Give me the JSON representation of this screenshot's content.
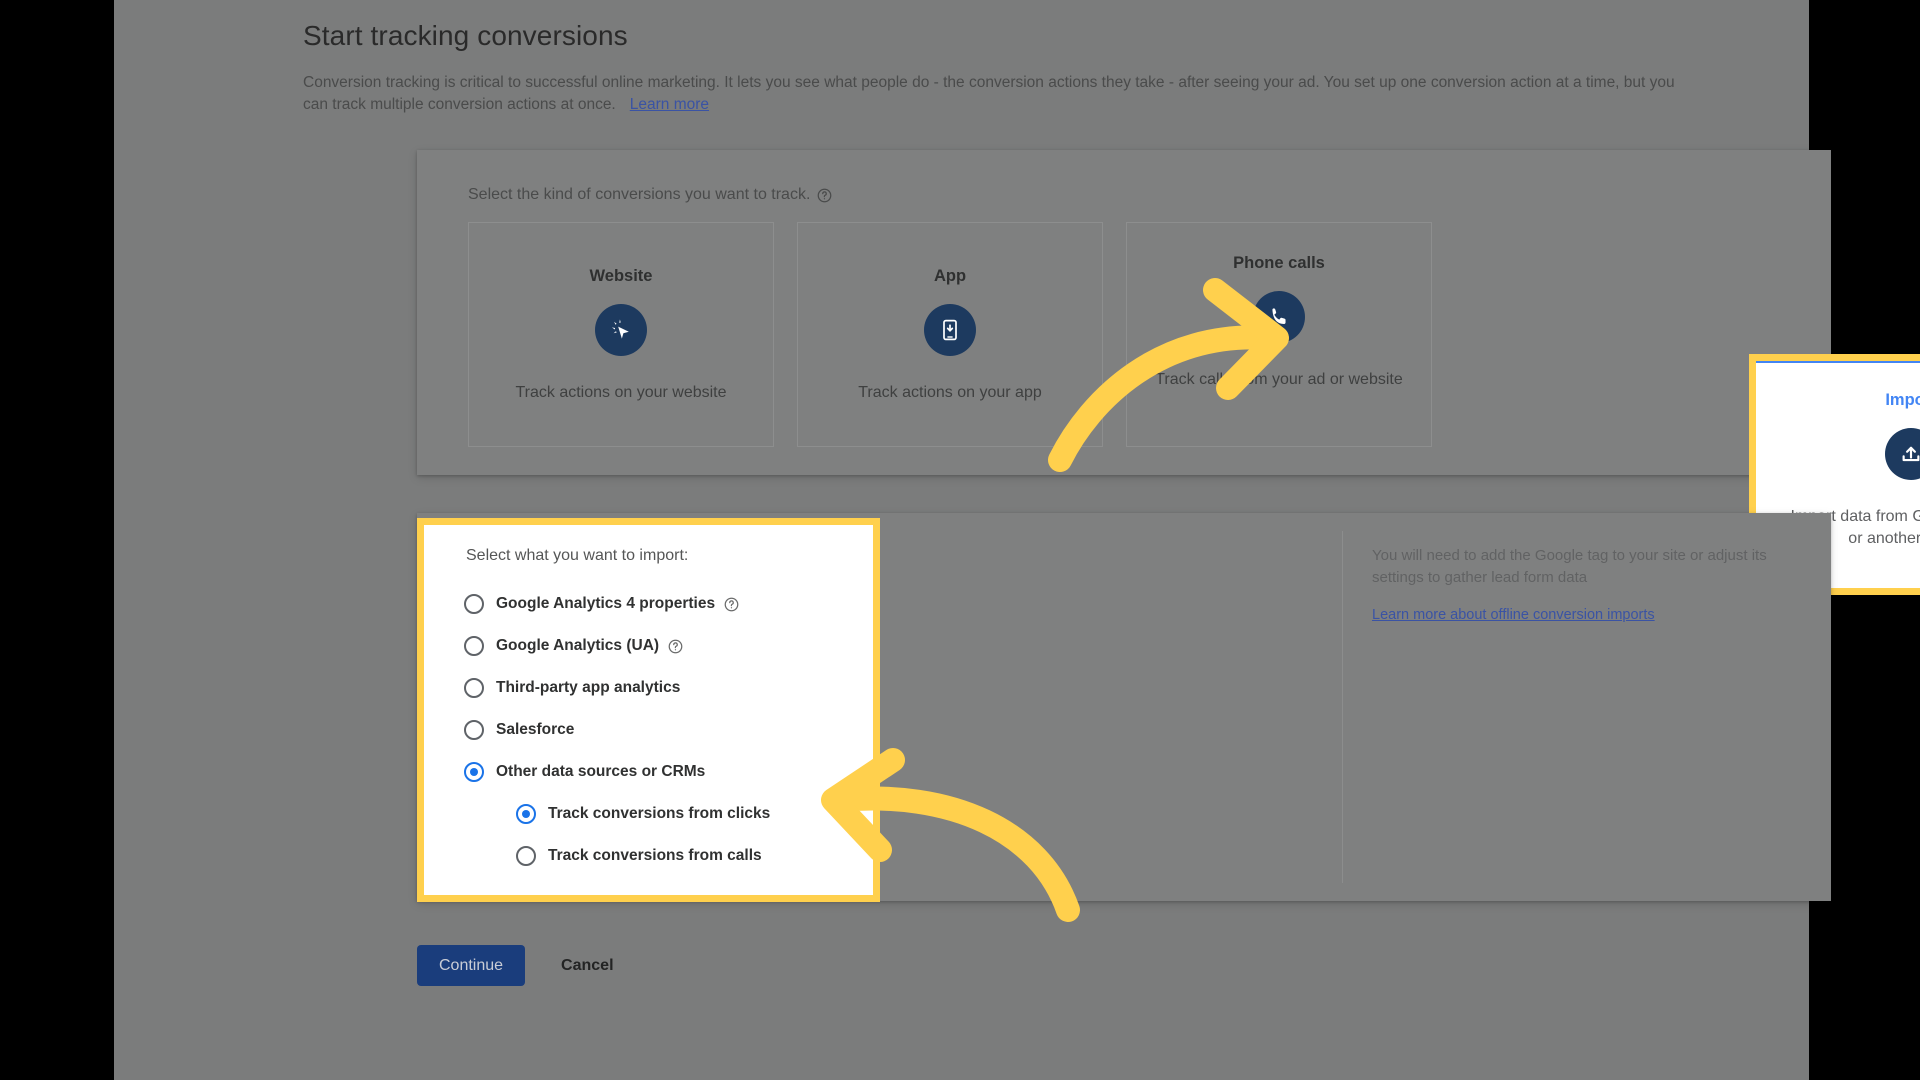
{
  "header": {
    "title": "Start tracking conversions",
    "intro": "Conversion tracking is critical to successful online marketing. It lets you see what people do - the conversion actions they take - after seeing your ad. You set up one conversion action at a time, but you can track multiple conversion actions at once.",
    "learn_more": "Learn more"
  },
  "kinds_panel": {
    "label": "Select the kind of conversions you want to track.",
    "help_icon": "help-circle-icon",
    "cards": [
      {
        "title": "Website",
        "desc": "Track actions on your website",
        "icon": "cursor-click-icon",
        "selected": false
      },
      {
        "title": "App",
        "desc": "Track actions on your app",
        "icon": "mobile-download-icon",
        "selected": false
      },
      {
        "title": "Phone calls",
        "desc": "Track calls from your ad or website",
        "icon": "phone-icon",
        "selected": false
      },
      {
        "title": "Import",
        "desc": "Import data from Google Analytics or another source",
        "icon": "upload-icon",
        "selected": true
      }
    ]
  },
  "import_panel": {
    "select_label": "Select what you want to import:",
    "options": [
      {
        "label": "Google Analytics 4 properties",
        "has_help": true,
        "checked": false,
        "sub": false
      },
      {
        "label": "Google Analytics (UA)",
        "has_help": true,
        "checked": false,
        "sub": false
      },
      {
        "label": "Third-party app analytics",
        "has_help": false,
        "checked": false,
        "sub": false
      },
      {
        "label": "Salesforce",
        "has_help": false,
        "checked": false,
        "sub": false
      },
      {
        "label": "Other data sources or CRMs",
        "has_help": false,
        "checked": true,
        "sub": false
      },
      {
        "label": "Track conversions from clicks",
        "has_help": false,
        "checked": true,
        "sub": true
      },
      {
        "label": "Track conversions from calls",
        "has_help": false,
        "checked": false,
        "sub": true
      }
    ],
    "note": "You will need to add the Google tag to your site or adjust its settings to gather lead form data",
    "note_link": "Learn more about offline conversion imports"
  },
  "footer": {
    "continue_label": "Continue",
    "cancel_label": "Cancel"
  },
  "annotations": {
    "highlight_color": "#ffd04d",
    "arrow_to_import": "curved-arrow-right-icon",
    "arrow_to_radios": "curved-arrow-left-icon",
    "import_highlight_target": "Import",
    "radio_highlight_target": "Select what you want to import:"
  },
  "colors": {
    "accent_blue": "#4285f4",
    "selected_radio": "#1a73e8",
    "icon_navy": "#1d3a5f",
    "button_blue": "#1a3d7c",
    "link_blue": "#3a53a4",
    "highlight_yellow": "#ffd04d",
    "page_dim": "#7b7c7c"
  }
}
